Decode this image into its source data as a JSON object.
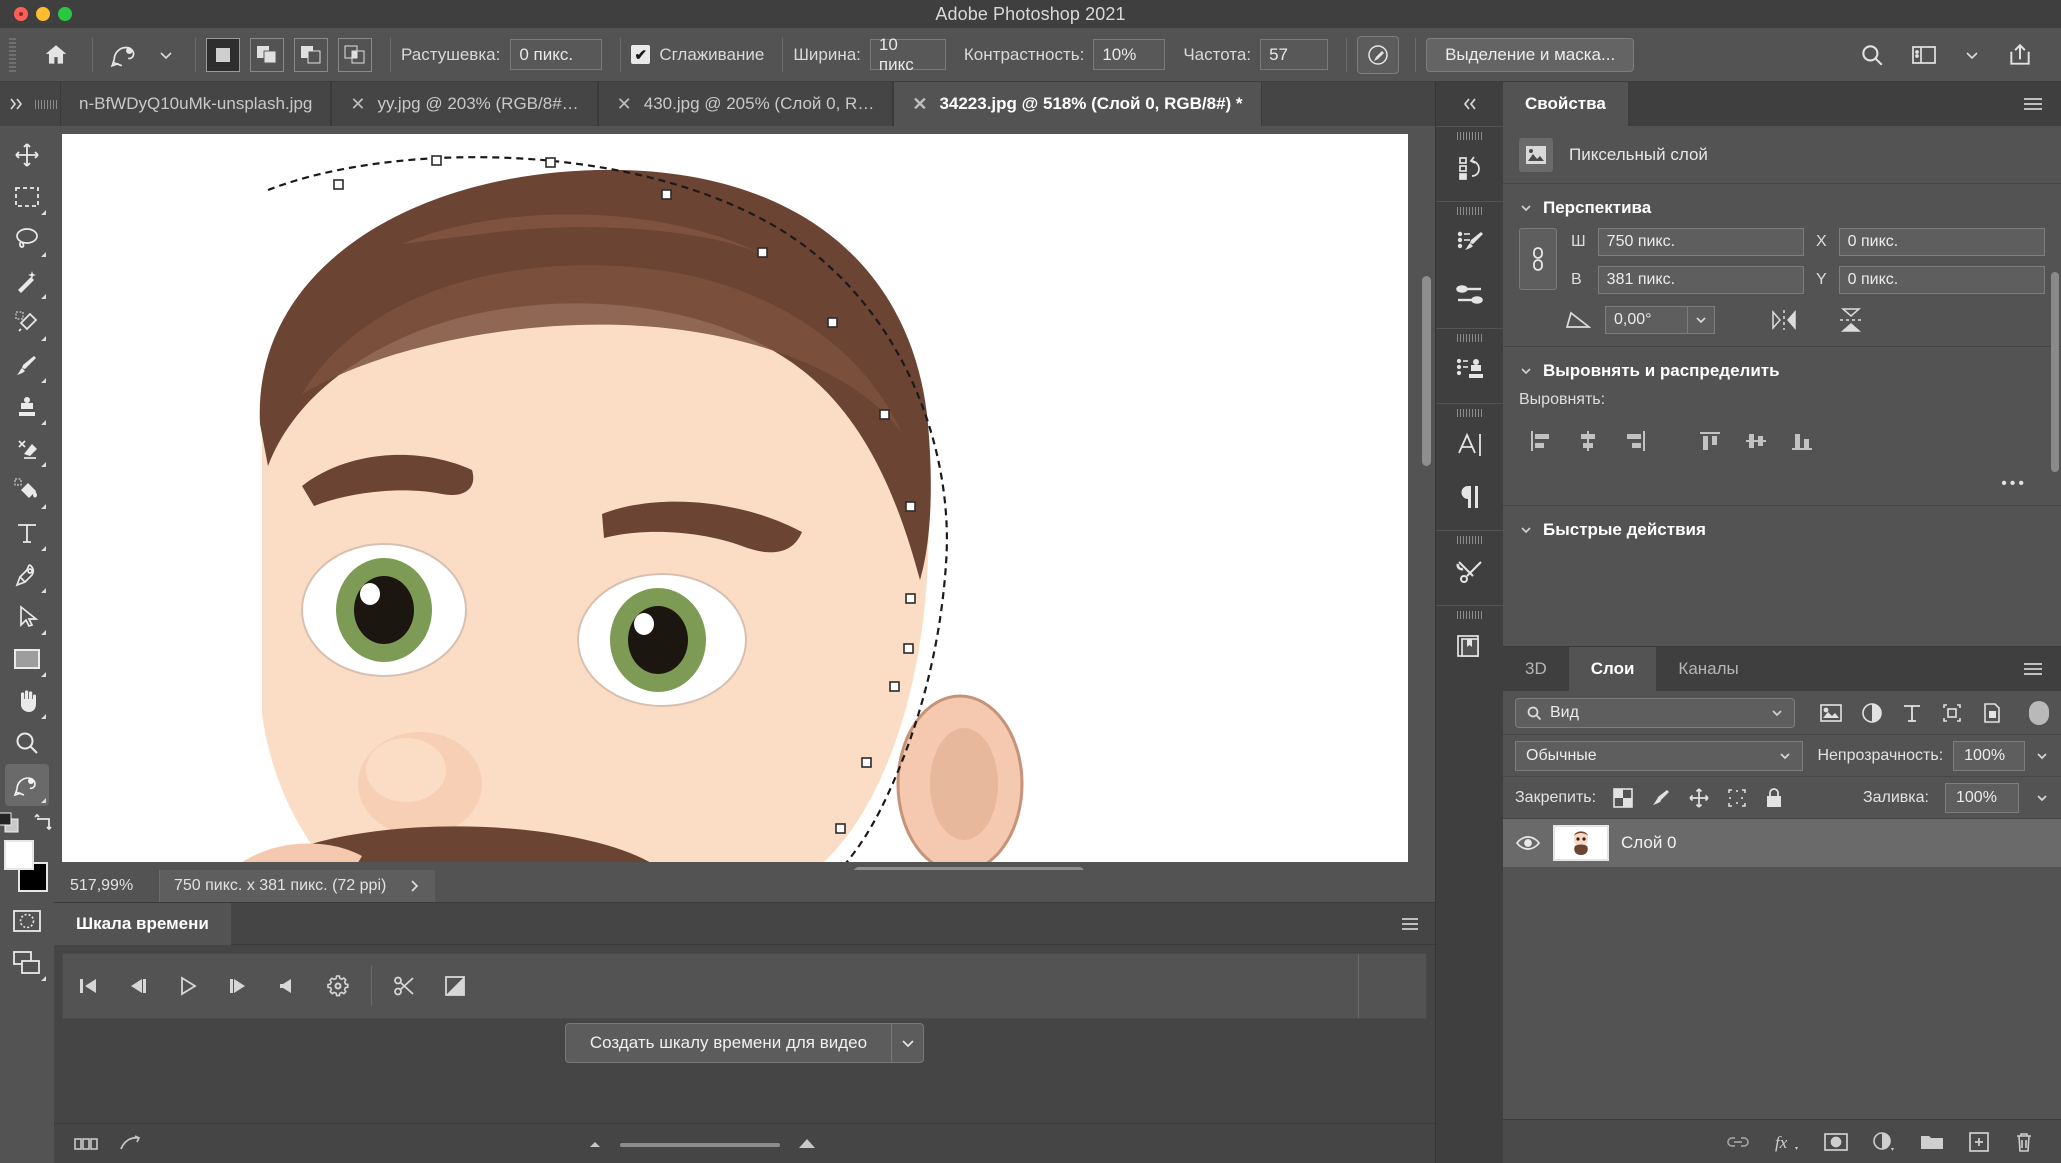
{
  "window": {
    "title": "Adobe Photoshop 2021",
    "controls": [
      "close",
      "minimize",
      "maximize"
    ]
  },
  "options_bar": {
    "home_icon": "home-icon",
    "tool_icon": "magnetic-lasso-icon",
    "tool_dropdown": "chevron-down-icon",
    "selection_modes": [
      "new-selection",
      "add-to-selection",
      "subtract-from-selection",
      "intersect-selection"
    ],
    "feather_label": "Растушевка:",
    "feather_value": "0 пикс.",
    "antialias_label": "Сглаживание",
    "antialias_checked": true,
    "width_label": "Ширина:",
    "width_value": "10 пикс",
    "contrast_label": "Контрастность:",
    "contrast_value": "10%",
    "frequency_label": "Частота:",
    "frequency_value": "57",
    "tablet_pressure_icon": "tablet-pressure-icon",
    "select_and_mask_label": "Выделение и маска...",
    "search_icon": "search-icon",
    "workspace_icon": "workspace-icon",
    "workspace_chevron": "chevron-down-icon",
    "share_icon": "share-icon"
  },
  "tabs": {
    "overflow_left_icon": "chevron-double-right-icon",
    "overflow_right_icon": "chevron-double-right-icon",
    "items": [
      {
        "label": "n-BfWDyQ10uMk-unsplash.jpg",
        "active": false,
        "closable": false
      },
      {
        "label": "yy.jpg @ 203% (RGB/8#…",
        "active": false,
        "closable": true
      },
      {
        "label": "430.jpg @ 205% (Слой 0, R…",
        "active": false,
        "closable": true
      },
      {
        "label": "34223.jpg @ 518% (Слой 0, RGB/8#) *",
        "active": true,
        "closable": true
      }
    ]
  },
  "left_toolbar": {
    "tools": [
      {
        "name": "move-tool",
        "icon": "move-icon",
        "has_flyout": false,
        "active": false
      },
      {
        "name": "marquee-tool",
        "icon": "rectangular-marquee-icon",
        "has_flyout": true,
        "active": false
      },
      {
        "name": "lasso-tool",
        "icon": "lasso-icon",
        "has_flyout": true,
        "active": false
      },
      {
        "name": "quick-selection-tool",
        "icon": "magic-wand-icon",
        "has_flyout": true,
        "active": false
      },
      {
        "name": "eyedropper-tool",
        "icon": "eyedropper-icon",
        "has_flyout": true,
        "active": false
      },
      {
        "name": "brush-tool",
        "icon": "brush-icon",
        "has_flyout": true,
        "active": false
      },
      {
        "name": "clone-stamp-tool",
        "icon": "clone-stamp-icon",
        "has_flyout": true,
        "active": false
      },
      {
        "name": "eraser-tool",
        "icon": "eraser-icon",
        "has_flyout": true,
        "active": false
      },
      {
        "name": "gradient-tool",
        "icon": "paint-bucket-icon",
        "has_flyout": true,
        "active": false
      },
      {
        "name": "type-tool",
        "icon": "type-icon",
        "has_flyout": true,
        "active": false
      },
      {
        "name": "pen-tool",
        "icon": "pen-icon",
        "has_flyout": true,
        "active": false
      },
      {
        "name": "path-selection-tool",
        "icon": "path-selection-arrow-icon",
        "has_flyout": true,
        "active": false
      },
      {
        "name": "shape-tool",
        "icon": "rectangle-shape-icon",
        "has_flyout": true,
        "active": false
      },
      {
        "name": "hand-tool",
        "icon": "hand-icon",
        "has_flyout": true,
        "active": false
      },
      {
        "name": "zoom-tool",
        "icon": "magnifier-icon",
        "has_flyout": false,
        "active": false
      },
      {
        "name": "magnetic-lasso-tool",
        "icon": "magnetic-lasso-icon",
        "has_flyout": true,
        "active": true
      }
    ],
    "default_colors_icon": "default-colors-icon",
    "swap_colors_icon": "swap-colors-icon",
    "foreground_color": "#ffffff",
    "background_color": "#000000",
    "quick_mask_icon": "quick-mask-icon",
    "screen_mode_icon": "screen-mode-icon"
  },
  "status_bar": {
    "zoom": "517,99%",
    "doc_size": "750 пикс. x 381 пикс. (72 ppi)",
    "expand_icon": "chevron-right-icon"
  },
  "timeline": {
    "tab_label": "Шкала времени",
    "menu_icon": "panel-menu-icon",
    "controls": [
      {
        "name": "go-to-first-frame-button",
        "icon": "skip-start-icon"
      },
      {
        "name": "previous-frame-button",
        "icon": "step-back-icon"
      },
      {
        "name": "play-button",
        "icon": "play-icon"
      },
      {
        "name": "next-frame-button",
        "icon": "step-forward-icon"
      },
      {
        "name": "audio-button",
        "icon": "speaker-icon"
      },
      {
        "name": "settings-button",
        "icon": "gear-icon"
      },
      {
        "name": "split-clip-button",
        "icon": "scissors-icon"
      },
      {
        "name": "transition-button",
        "icon": "transition-icon"
      }
    ],
    "create_button_label": "Создать шкалу времени для видео",
    "create_button_arrow": "chevron-down-icon",
    "footer_icons": [
      "filmstrip-icon",
      "render-video-icon"
    ],
    "zoom_slider": {
      "small_icon": "triangle-small-icon",
      "large_icon": "triangle-large-icon"
    }
  },
  "icon_dock": {
    "collapse_icon": "chevron-double-left-icon",
    "groups": [
      [
        {
          "name": "history-panel-icon",
          "icon": "history-icon"
        }
      ],
      [
        {
          "name": "brush-settings-panel-icon",
          "icon": "brush-preset-icon"
        },
        {
          "name": "brushes-panel-icon",
          "icon": "brushes-icon"
        }
      ],
      [
        {
          "name": "clone-source-panel-icon",
          "icon": "clone-source-icon"
        }
      ],
      [
        {
          "name": "character-panel-icon",
          "icon": "character-icon"
        },
        {
          "name": "paragraph-panel-icon",
          "icon": "paragraph-icon"
        }
      ],
      [
        {
          "name": "tool-presets-panel-icon",
          "icon": "tools-icon"
        }
      ],
      [
        {
          "name": "libraries-panel-icon",
          "icon": "libraries-icon"
        }
      ]
    ]
  },
  "properties": {
    "tab_label": "Свойства",
    "menu_icon": "panel-menu-icon",
    "layer_type_icon": "pixel-layer-icon",
    "layer_type_label": "Пиксельный слой",
    "perspective": {
      "title": "Перспектива",
      "link_icon": "link-dimensions-icon",
      "w_label": "Ш",
      "w_value": "750 пикс.",
      "x_label": "X",
      "x_value": "0 пикс.",
      "h_label": "В",
      "h_value": "381 пикс.",
      "y_label": "Y",
      "y_value": "0 пикс.",
      "angle_icon": "angle-icon",
      "angle_value": "0,00°",
      "angle_dropdown": "chevron-down-icon",
      "flip_horizontal_icon": "flip-horizontal-icon",
      "flip_vertical_icon": "flip-vertical-icon"
    },
    "align": {
      "title": "Выровнять и распределить",
      "align_label": "Выровнять:",
      "buttons": [
        "align-left-edges-icon",
        "align-horizontal-centers-icon",
        "align-right-edges-icon",
        "align-top-edges-icon",
        "align-vertical-centers-icon",
        "align-bottom-edges-icon"
      ],
      "more_label": "•••"
    },
    "quick_actions": {
      "title": "Быстрые действия"
    }
  },
  "layers": {
    "tabs": [
      {
        "label": "3D",
        "active": false
      },
      {
        "label": "Слои",
        "active": true
      },
      {
        "label": "Каналы",
        "active": false
      }
    ],
    "menu_icon": "panel-menu-icon",
    "filter_placeholder": "Вид",
    "filter_search_icon": "search-icon",
    "filter_chevron": "chevron-down-icon",
    "filter_types": [
      "filter-pixel-icon",
      "filter-adjustment-icon",
      "filter-type-icon",
      "filter-shape-icon",
      "filter-smart-object-icon"
    ],
    "filter_toggle_icon": "filter-toggle-icon",
    "blend_mode": "Обычные",
    "blend_chevron": "chevron-down-icon",
    "opacity_label": "Непрозрачность:",
    "opacity_value": "100%",
    "opacity_chevron": "chevron-down-icon",
    "lock_label": "Закрепить:",
    "lock_icons": [
      "lock-transparent-pixels-icon",
      "lock-image-pixels-icon",
      "lock-position-icon",
      "lock-artboard-icon",
      "lock-all-icon"
    ],
    "fill_label": "Заливка:",
    "fill_value": "100%",
    "fill_chevron": "chevron-down-icon",
    "items": [
      {
        "name": "Слой 0",
        "visible": true,
        "selected": true,
        "thumbnail": "layer-thumbnail"
      }
    ],
    "footer_icons": [
      "link-layers-icon",
      "layer-styles-icon",
      "layer-mask-icon",
      "adjustment-layer-icon",
      "new-group-icon",
      "new-layer-icon",
      "delete-layer-icon"
    ]
  },
  "colors": {
    "app_bg": "#535353",
    "panel_bg": "#3f3f3f",
    "tab_active": "#535353",
    "accent_text": "#ffffff"
  }
}
